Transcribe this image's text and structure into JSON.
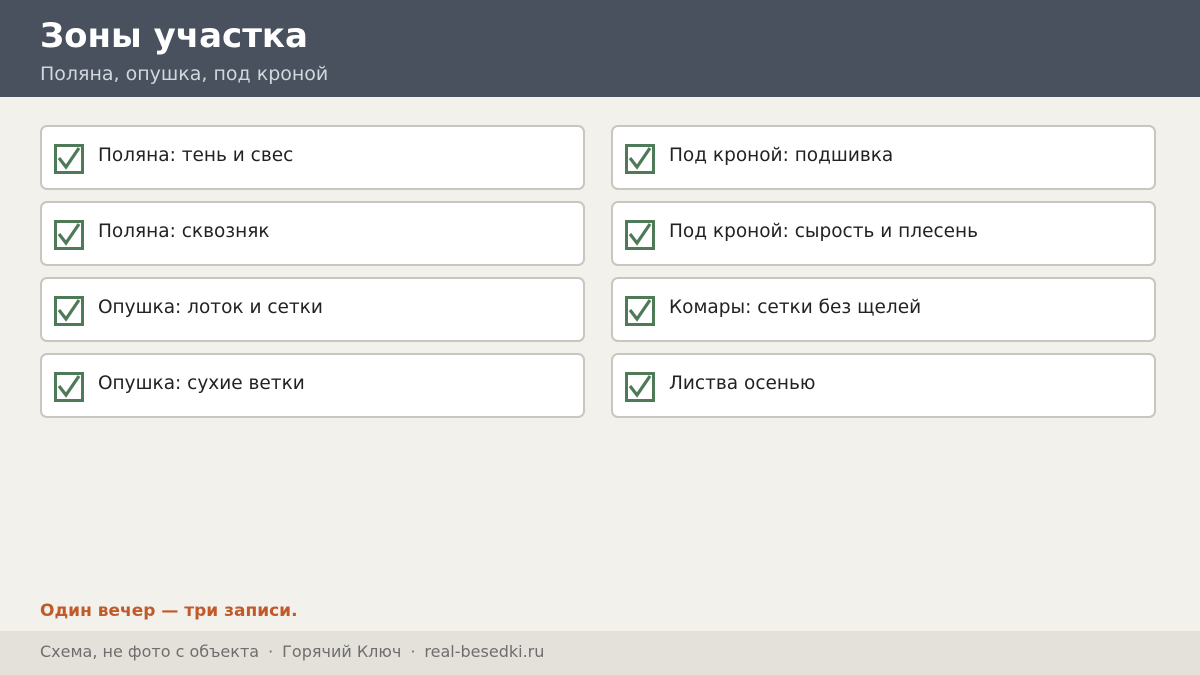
{
  "header": {
    "title": "Зоны участка",
    "subtitle": "Поляна, опушка, под кроной"
  },
  "checklist": {
    "check_color": "#4f7a58",
    "items": [
      {
        "label": "Поляна: тень и свес",
        "checked": true
      },
      {
        "label": "Под кроной: подшивка",
        "checked": true
      },
      {
        "label": "Поляна: сквозняк",
        "checked": true
      },
      {
        "label": "Под кроной: сырость и плесень",
        "checked": true
      },
      {
        "label": "Опушка: лоток и сетки",
        "checked": true
      },
      {
        "label": "Комары: сетки без щелей",
        "checked": true
      },
      {
        "label": "Опушка: сухие ветки",
        "checked": true
      },
      {
        "label": "Листва осенью",
        "checked": true
      }
    ]
  },
  "note": {
    "text": "Один вечер — три записи.",
    "color": "#c05a2a"
  },
  "footer": {
    "disclaimer": "Схема, не фото с объекта",
    "separator": "·",
    "city": "Горячий Ключ",
    "site": "real-besedki.ru"
  }
}
